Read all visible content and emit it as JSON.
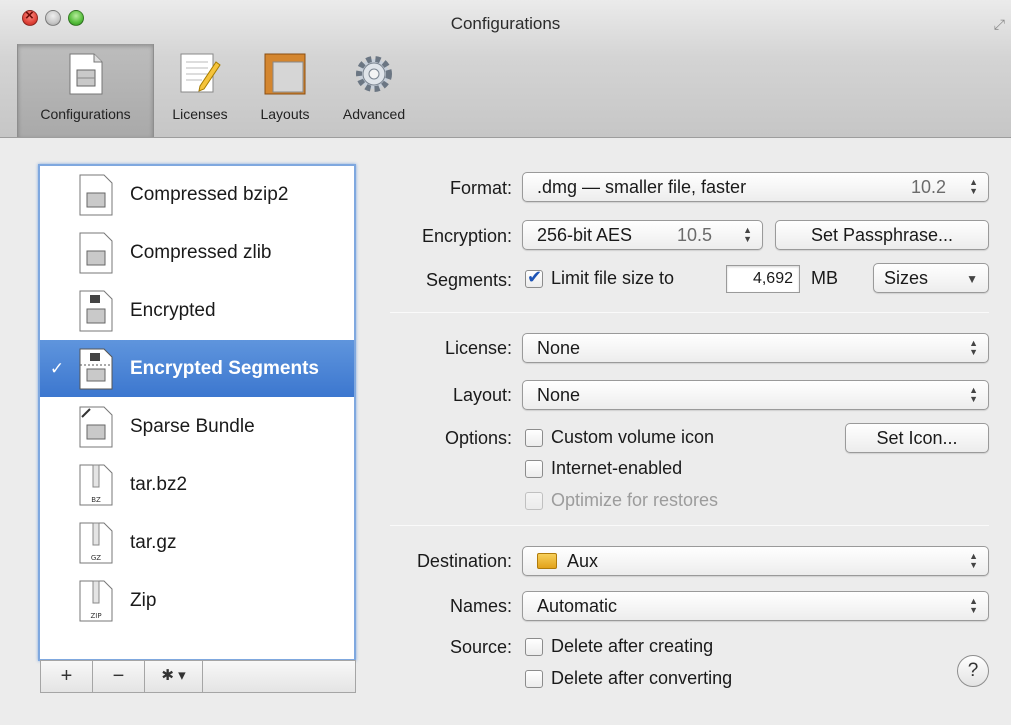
{
  "window": {
    "title": "Configurations"
  },
  "toolbar": {
    "items": [
      {
        "label": "Configurations",
        "icon": "disk-image-icon",
        "active": true
      },
      {
        "label": "Licenses",
        "icon": "document-pencil-icon",
        "active": false
      },
      {
        "label": "Layouts",
        "icon": "ruler-frame-icon",
        "active": false
      },
      {
        "label": "Advanced",
        "icon": "gear-icon",
        "active": false
      }
    ]
  },
  "configurations": {
    "items": [
      {
        "name": "Compressed bzip2",
        "icon": "disk-image-icon",
        "selected": false
      },
      {
        "name": "Compressed zlib",
        "icon": "disk-image-icon",
        "selected": false
      },
      {
        "name": "Encrypted",
        "icon": "locked-disk-image-icon",
        "selected": false
      },
      {
        "name": "Encrypted Segments",
        "icon": "locked-segmented-disk-image-icon",
        "selected": true,
        "check": "✓"
      },
      {
        "name": "Sparse Bundle",
        "icon": "sparse-bundle-icon",
        "selected": false
      },
      {
        "name": "tar.bz2",
        "icon": "zip-archive-icon",
        "badge": "BZ",
        "selected": false
      },
      {
        "name": "tar.gz",
        "icon": "zip-archive-icon",
        "badge": "GZ",
        "selected": false
      },
      {
        "name": "Zip",
        "icon": "zip-archive-icon",
        "badge": "ZIP",
        "selected": false
      }
    ],
    "buttons": {
      "add": "+",
      "remove": "−",
      "gear": "✱ ▾"
    }
  },
  "settings": {
    "format": {
      "label": "Format:",
      "value": ".dmg — smaller file, faster",
      "version": "10.2"
    },
    "encryption": {
      "label": "Encryption:",
      "value": "256-bit AES",
      "version": "10.5",
      "button": "Set Passphrase..."
    },
    "segments": {
      "label": "Segments:",
      "checkbox_label": "Limit file size to",
      "checked": true,
      "size": "4,692",
      "unit": "MB",
      "sizes_button": "Sizes"
    },
    "license": {
      "label": "License:",
      "value": "None"
    },
    "layout": {
      "label": "Layout:",
      "value": "None"
    },
    "options": {
      "label": "Options:",
      "custom_icon": {
        "label": "Custom volume icon",
        "checked": false
      },
      "set_icon_button": "Set Icon...",
      "internet_enabled": {
        "label": "Internet-enabled",
        "checked": false
      },
      "optimize": {
        "label": "Optimize for restores",
        "checked": false,
        "disabled": true
      }
    },
    "destination": {
      "label": "Destination:",
      "value": "Aux"
    },
    "names": {
      "label": "Names:",
      "value": "Automatic"
    },
    "source": {
      "label": "Source:",
      "delete_after_creating": {
        "label": "Delete after creating",
        "checked": false
      },
      "delete_after_converting": {
        "label": "Delete after converting",
        "checked": false
      }
    },
    "help": "?"
  },
  "colors": {
    "selection": "#3c77cf",
    "focus_ring": "#7fa8df",
    "check": "#1d54b6"
  }
}
